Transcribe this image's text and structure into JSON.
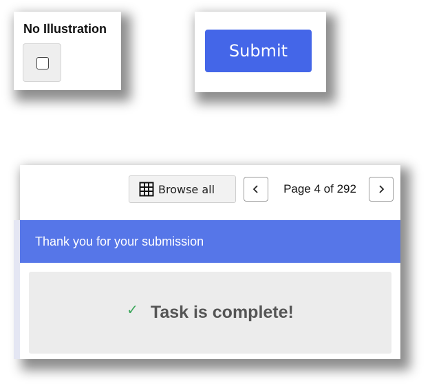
{
  "illustration_option": {
    "label": "No Illustration",
    "checked": false
  },
  "submit": {
    "label": "Submit",
    "color": "#4466e8"
  },
  "navigation": {
    "browse_label": "Browse all",
    "browse_icon": "grid-icon",
    "prev_icon": "chevron-left-icon",
    "next_icon": "chevron-right-icon",
    "page_text": "Page 4 of 292"
  },
  "result": {
    "banner_text": "Thank you for your submission",
    "banner_color": "#5676e8",
    "status_icon": "check-icon",
    "status_text": "Task is complete!"
  }
}
